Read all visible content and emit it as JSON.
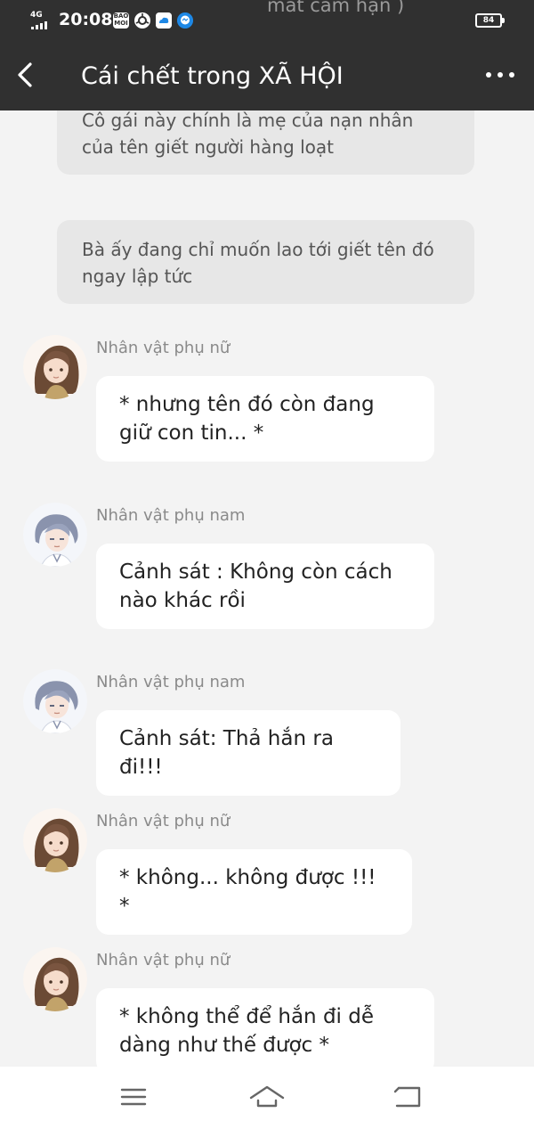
{
  "status_bar": {
    "network_label": "4G",
    "time": "20:08",
    "notification_icons": [
      "bao-moi-icon",
      "chrome-icon",
      "cloud-icon",
      "messenger-icon"
    ],
    "notification_badge_text": "BAO MOI",
    "battery_level": "84"
  },
  "background_text": "mất cảm hận )",
  "header": {
    "title": "Cái chết trong XÃ HỘI"
  },
  "narrations": [
    "Cô gái này chính là mẹ của nạn nhân của tên giết người hàng loạt",
    "Bà ấy đang chỉ muốn lao tới giết tên đó ngay lập tức"
  ],
  "messages": [
    {
      "sender": "Nhân vật phụ nữ",
      "avatar": "female",
      "text": "* nhưng tên đó còn đang giữ con tin... *"
    },
    {
      "sender": "Nhân vật phụ nam",
      "avatar": "male",
      "text": "Cảnh sát : Không còn cách nào khác rồi"
    },
    {
      "sender": "Nhân vật phụ nam",
      "avatar": "male",
      "text": "Cảnh sát: Thả hắn ra đi!!!"
    },
    {
      "sender": "Nhân vật phụ nữ",
      "avatar": "female",
      "text": "* không... không được !!! *"
    },
    {
      "sender": "Nhân vật phụ nữ",
      "avatar": "female",
      "text": "* không thể để hắn đi dễ dàng như thế được *"
    }
  ],
  "colors": {
    "header_bg": "#303030",
    "chat_bg": "#f3f3f3",
    "narration_bg": "#e7e7e7",
    "bubble_bg": "#ffffff"
  }
}
